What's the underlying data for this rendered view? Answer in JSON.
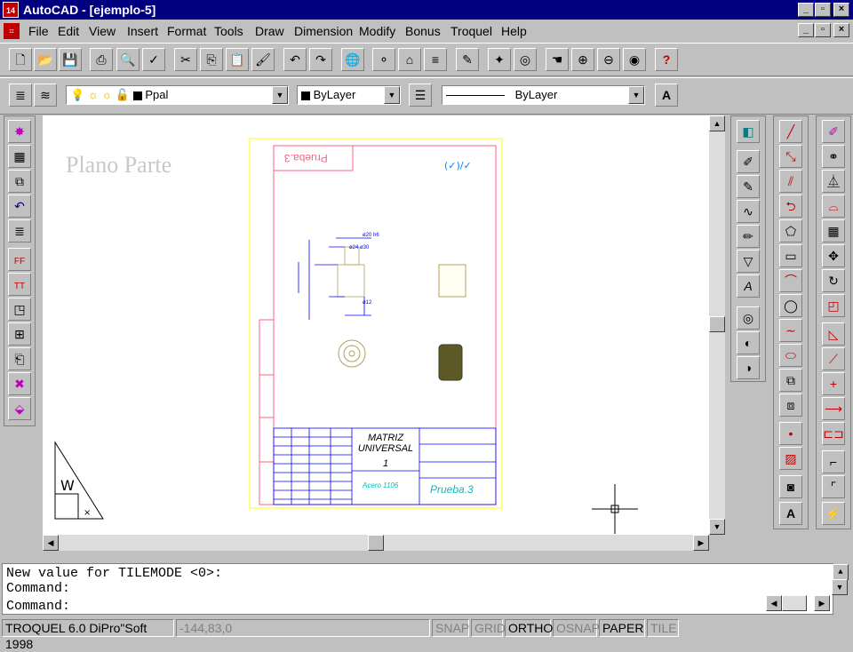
{
  "window": {
    "title": "AutoCAD - [ejemplo-5]",
    "app_icon": "14"
  },
  "menu": {
    "items": [
      "File",
      "Edit",
      "View",
      "Insert",
      "Format",
      "Tools",
      "Draw",
      "Dimension",
      "Modify",
      "Bonus",
      "Troquel",
      "Help"
    ]
  },
  "layer_toolbar": {
    "layer": "Ppal",
    "color": "ByLayer",
    "linetype": "ByLayer"
  },
  "drawing": {
    "label": "Plano Parte",
    "tag": "Prueba.3",
    "title": "MATRIZ UNIVERSAL",
    "number": "1",
    "material": "Acero 1106",
    "part_name": "Prueba.3"
  },
  "command": {
    "lines": [
      "New value for TILEMODE <0>:",
      "Command:"
    ],
    "prompt": "Command:"
  },
  "status": {
    "app": "TROQUEL 6.0 DiPro\"Soft 1998",
    "coords": "-144,83,0",
    "modes": [
      {
        "label": "SNAP",
        "on": false
      },
      {
        "label": "GRID",
        "on": false
      },
      {
        "label": "ORTHO",
        "on": true
      },
      {
        "label": "OSNAP",
        "on": false
      },
      {
        "label": "PAPER",
        "on": true
      },
      {
        "label": "TILE",
        "on": false
      }
    ]
  }
}
